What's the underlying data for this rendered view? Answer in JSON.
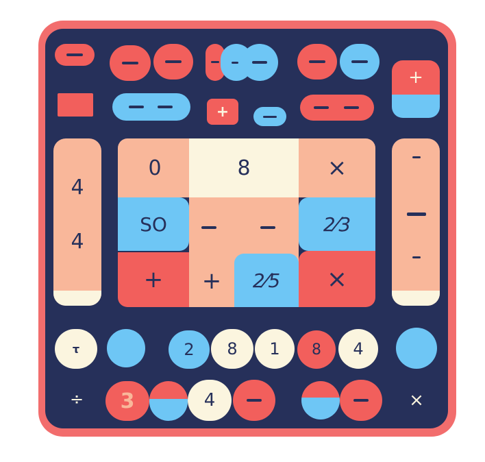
{
  "board": {
    "center_grid": [
      [
        "0",
        "8",
        "×"
      ],
      [
        "SO",
        "−   −",
        "2⁄3"
      ],
      [
        "+",
        "+",
        "2⁄5",
        "×"
      ]
    ],
    "left_bar": [
      "4",
      "4"
    ],
    "right_bar": [
      "−",
      "−",
      "−"
    ],
    "top_row": [
      "−",
      "−",
      "−",
      "−",
      "−",
      "−",
      "−"
    ],
    "mid_row": [
      "− −",
      "+",
      "−",
      "− −"
    ],
    "corner_button": "+",
    "bottom_row_1": [
      "τ",
      "",
      "2",
      "8",
      "1",
      "8",
      "4",
      ""
    ],
    "bottom_row_2": [
      "÷",
      "3",
      "",
      "4",
      "−",
      "",
      "−",
      "×"
    ]
  },
  "colors": {
    "frame": "#f26d6d",
    "board": "#26305a",
    "red": "#f25f5c",
    "blue": "#6ec6f5",
    "peach": "#f9b79a",
    "cream": "#fbf5df"
  }
}
